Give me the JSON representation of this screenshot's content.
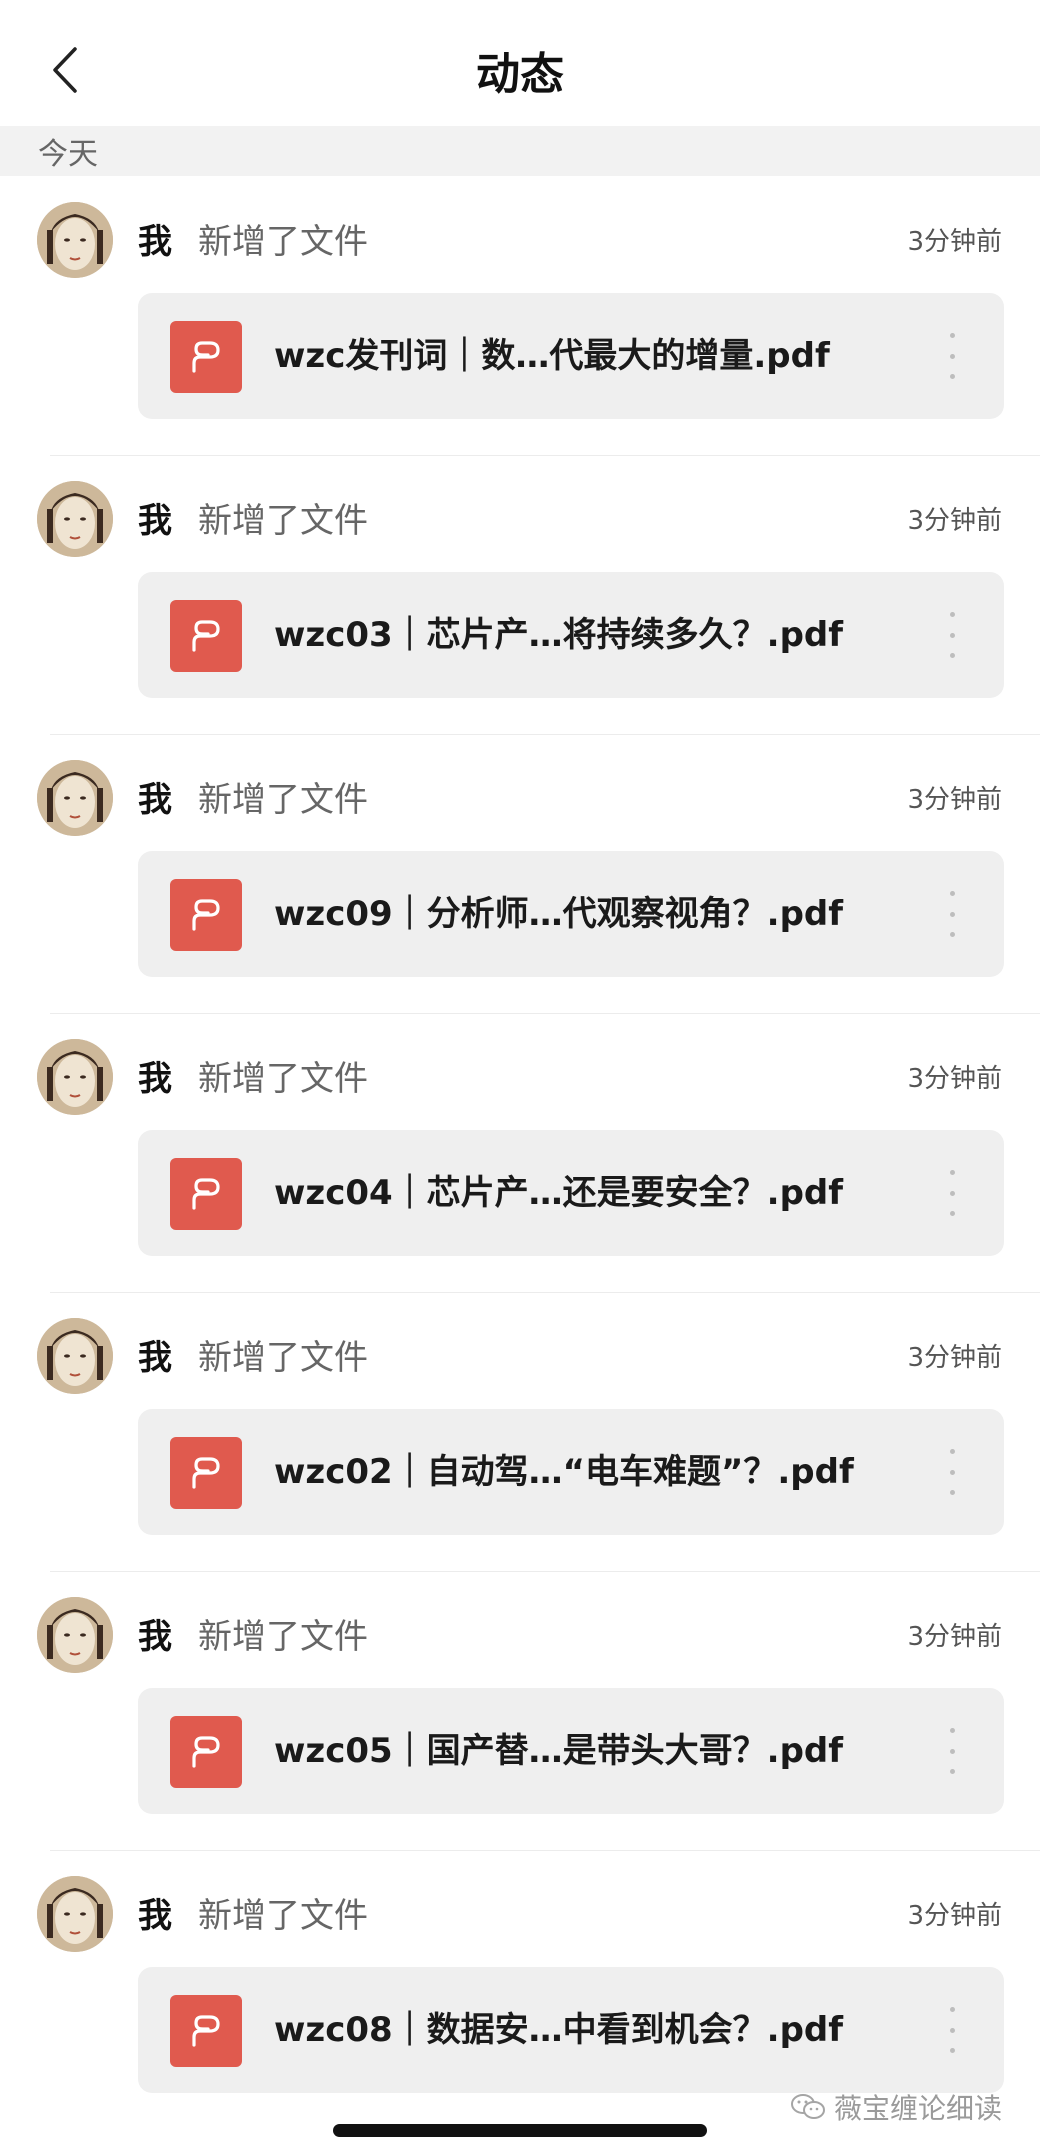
{
  "header": {
    "title": "动态"
  },
  "section": {
    "label": "今天"
  },
  "feed": [
    {
      "actor": "我",
      "action": "新增了文件",
      "time": "3分钟前",
      "file": "wzc发刊词｜数…代最大的增量.pdf"
    },
    {
      "actor": "我",
      "action": "新增了文件",
      "time": "3分钟前",
      "file": "wzc03｜芯片产…将持续多久？.pdf"
    },
    {
      "actor": "我",
      "action": "新增了文件",
      "time": "3分钟前",
      "file": "wzc09｜分析师…代观察视角？.pdf"
    },
    {
      "actor": "我",
      "action": "新增了文件",
      "time": "3分钟前",
      "file": "wzc04｜芯片产…还是要安全？.pdf"
    },
    {
      "actor": "我",
      "action": "新增了文件",
      "time": "3分钟前",
      "file": "wzc02｜自动驾…“电车难题”？.pdf"
    },
    {
      "actor": "我",
      "action": "新增了文件",
      "time": "3分钟前",
      "file": "wzc05｜国产替…是带头大哥？.pdf"
    },
    {
      "actor": "我",
      "action": "新增了文件",
      "time": "3分钟前",
      "file": "wzc08｜数据安…中看到机会？.pdf"
    }
  ],
  "watermark": {
    "text": "薇宝缠论细读"
  },
  "colors": {
    "pdf_icon": "#e05a4e",
    "section_bg": "#f2f2f2",
    "card_bg": "#efefef"
  },
  "icons": {
    "back": "chevron-left-icon",
    "file": "pdf-icon",
    "more": "more-vertical-icon",
    "watermark": "wechat-icon"
  }
}
